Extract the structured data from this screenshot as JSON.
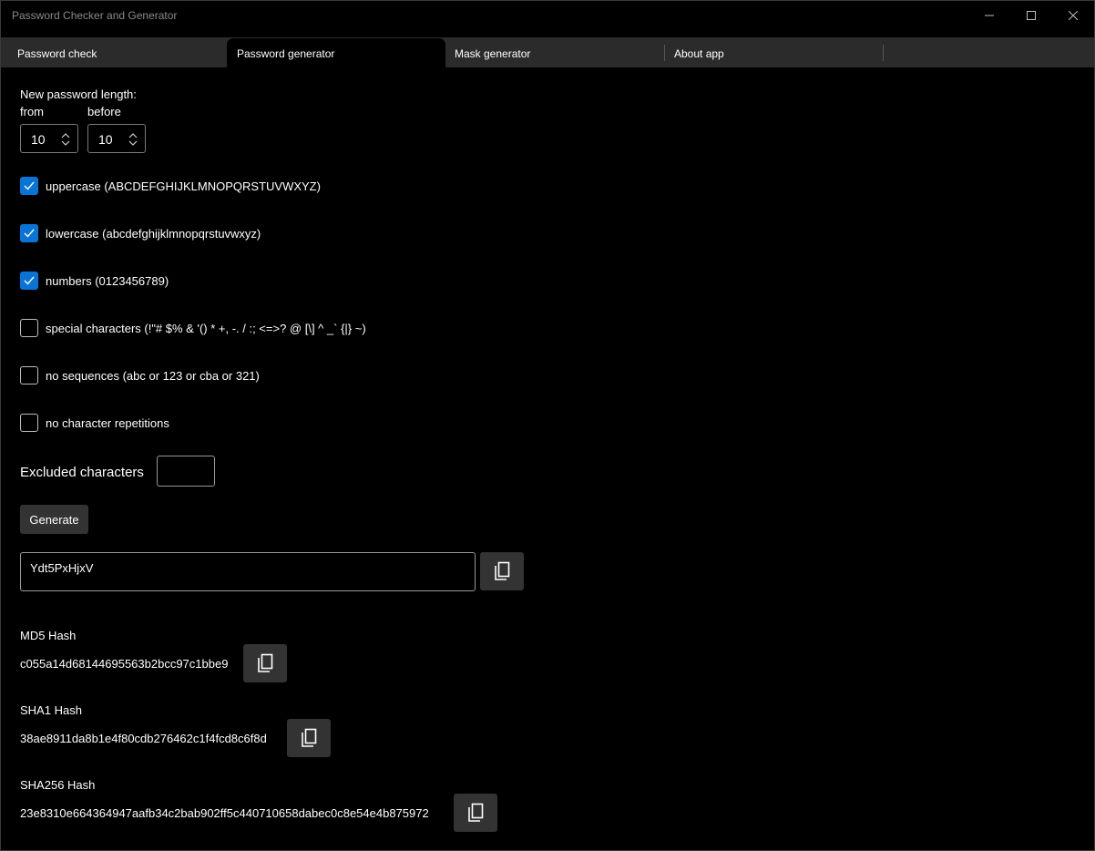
{
  "window": {
    "title": "Password Checker and Generator"
  },
  "tabs": [
    {
      "label": "Password check"
    },
    {
      "label": "Password generator"
    },
    {
      "label": "Mask generator"
    },
    {
      "label": "About app"
    }
  ],
  "length": {
    "heading": "New password length:",
    "from_label": "from",
    "before_label": "before",
    "from_value": "10",
    "before_value": "10"
  },
  "options": [
    {
      "label": "uppercase (ABCDEFGHIJKLMNOPQRSTUVWXYZ)",
      "checked": true
    },
    {
      "label": "lowercase (abcdefghijklmnopqrstuvwxyz)",
      "checked": true
    },
    {
      "label": "numbers (0123456789)",
      "checked": true
    },
    {
      "label": "special characters (!\"# $% & '() * +, -. / :; <=>? @ [\\] ^ _` {|} ~)",
      "checked": false
    },
    {
      "label": "no sequences (abc or 123 or cba or 321)",
      "checked": false
    },
    {
      "label": "no character repetitions",
      "checked": false
    }
  ],
  "excluded": {
    "label": "Excluded characters",
    "value": ""
  },
  "generate_label": "Generate",
  "password": {
    "value": "Ydt5PxHjxV"
  },
  "hashes": {
    "md5": {
      "label": "MD5 Hash",
      "value": "c055a14d68144695563b2bcc97c1bbe9"
    },
    "sha1": {
      "label": "SHA1 Hash",
      "value": "38ae8911da8b1e4f80cdb276462c1f4fcd8c6f8d"
    },
    "sha256": {
      "label": "SHA256 Hash",
      "value": "23e8310e664364947aafb34c2bab902ff5c440710658dabec0c8e54e4b875972"
    }
  },
  "colors": {
    "accent": "#0a74d6",
    "background": "#000000",
    "tabbar": "#2b2b2b",
    "button": "#333333"
  }
}
